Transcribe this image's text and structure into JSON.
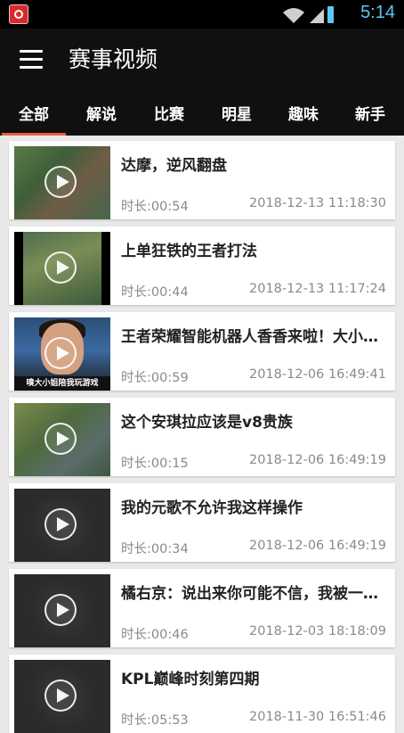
{
  "status_bar": {
    "time": "5:14",
    "icons": [
      "app-icon",
      "wifi-icon",
      "signal-icon",
      "battery-icon"
    ]
  },
  "header": {
    "title": "赛事视频",
    "tabs": [
      {
        "label": "全部",
        "active": true
      },
      {
        "label": "解说",
        "active": false
      },
      {
        "label": "比赛",
        "active": false
      },
      {
        "label": "明星",
        "active": false
      },
      {
        "label": "趣味",
        "active": false
      },
      {
        "label": "新手",
        "active": false
      }
    ]
  },
  "colors": {
    "header_bg": "#101010",
    "tab_indicator": "#e8613a",
    "status_time": "#5ec7f2",
    "list_bg": "#e9e9e9"
  },
  "videos": [
    {
      "title": "达摩，逆风翻盘",
      "duration": "时长:00:54",
      "date": "2018-12-13 11:18:30"
    },
    {
      "title": "上单狂铁的王者打法",
      "duration": "时长:00:44",
      "date": "2018-12-13 11:17:24"
    },
    {
      "title": "王者荣耀智能机器人香香来啦！大小…",
      "duration": "时长:00:59",
      "date": "2018-12-06 16:49:41",
      "thumb_caption": "嗅大小姐陪我玩游戏"
    },
    {
      "title": "这个安琪拉应该是v8贵族",
      "duration": "时长:00:15",
      "date": "2018-12-06 16:49:19"
    },
    {
      "title": "我的元歌不允许我这样操作",
      "duration": "时长:00:34",
      "date": "2018-12-06 16:49:19"
    },
    {
      "title": "橘右京：说出来你可能不信，我被一…",
      "duration": "时长:00:46",
      "date": "2018-12-03 18:18:09"
    },
    {
      "title": "KPL巅峰时刻第四期",
      "duration": "时长:05:53",
      "date": "2018-11-30 16:51:46"
    }
  ]
}
